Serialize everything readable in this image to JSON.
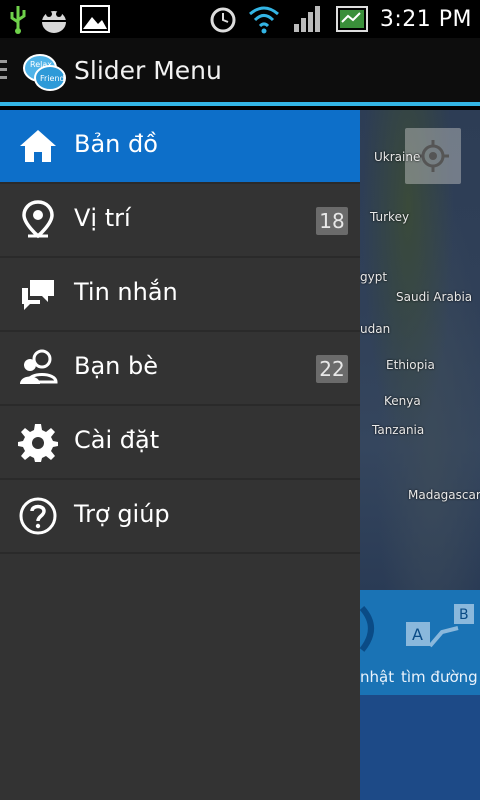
{
  "status_bar": {
    "time": "3:21 PM"
  },
  "action_bar": {
    "title": "Slider Menu",
    "logo_text": "Relax ci Friend"
  },
  "map": {
    "labels": [
      "Ukraine",
      "Turkey",
      "gypt",
      "Saudi Arabia",
      "udan",
      "Ethiopia",
      "Kenya",
      "Tanzania",
      "Madagascar"
    ],
    "bottom_labels": [
      "nhật",
      "tìm đường"
    ]
  },
  "drawer": {
    "items": [
      {
        "label": "Bản đồ",
        "icon": "home-icon",
        "badge": ""
      },
      {
        "label": "Vị trí",
        "icon": "location-pin-icon",
        "badge": "18"
      },
      {
        "label": "Tin nhắn",
        "icon": "chat-icon",
        "badge": ""
      },
      {
        "label": "Bạn bè",
        "icon": "friends-icon",
        "badge": "22"
      },
      {
        "label": "Cài đặt",
        "icon": "gear-icon",
        "badge": ""
      },
      {
        "label": "Trợ giúp",
        "icon": "help-icon",
        "badge": ""
      }
    ]
  },
  "colors": {
    "accent": "#33b5e5",
    "active_item": "#0d6fc9",
    "drawer_bg": "#333333"
  }
}
